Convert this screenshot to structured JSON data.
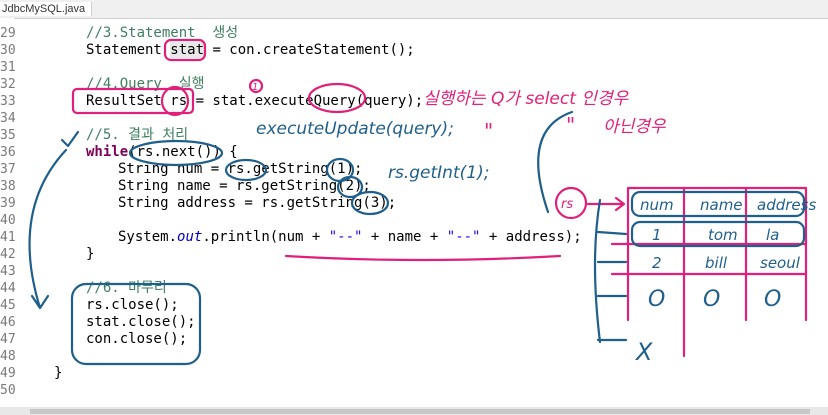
{
  "tab": {
    "file_label": "JdbcMySQL.java"
  },
  "line_numbers": [
    "29",
    "30",
    "31",
    "32",
    "33",
    "34",
    "35",
    "36",
    "37",
    "38",
    "39",
    "40",
    "41",
    "42",
    "43",
    "44",
    "45",
    "46",
    "47",
    "48",
    "49",
    "50"
  ],
  "code": {
    "l29": "//3.Statement  생성",
    "l30a": "Statement ",
    "l30b": "stat",
    "l30c": " = con.createStatement();",
    "l32": "//4.Query  실행",
    "l33": "ResultSet rs = stat.executeQuery(query);",
    "l35": "//5. 결과 처리",
    "l36kw": "while",
    "l36": "(rs.next()) {",
    "l37": "String num = rs.getString(1);",
    "l38": "String name = rs.getString(2);",
    "l39": "String address = rs.getString(3);",
    "l41a": "System.",
    "l41b": "out",
    "l41c": ".println(num + ",
    "l41s1": "\"--\"",
    "l41d": " + name + ",
    "l41s2": "\"--\"",
    "l41e": " + address);",
    "l42": "}",
    "l44": "//6. 마무리",
    "l45": "rs.close();",
    "l46": "stat.close();",
    "l47": "con.close();",
    "l49": "}"
  },
  "annotations": {
    "circle_one": "1",
    "korean_select": "실행하는 Q가 select 인경우",
    "ditto_1": "\"",
    "ditto_2": "\"",
    "korean_else": "아닌경우",
    "execute_update": "executeUpdate(query);",
    "get_int": "rs.getInt(1);",
    "rs_label": "rs",
    "table_headers": [
      "num",
      "name",
      "address"
    ],
    "row1": [
      "1",
      "tom",
      "la"
    ],
    "row2": [
      "2",
      "bill",
      "seoul"
    ],
    "row3": [
      "O",
      "O",
      "O"
    ],
    "end_mark": "X"
  },
  "colors": {
    "comment": "#3f7f5f",
    "keyword": "#7f0055",
    "string": "#2a00ff",
    "pink_ink": "#e0207a",
    "blue_ink": "#1f5f8b"
  }
}
